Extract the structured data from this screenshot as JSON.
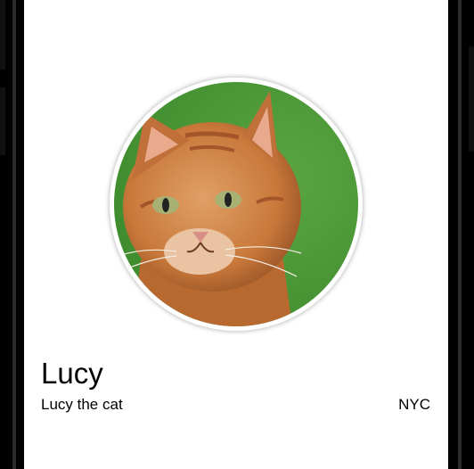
{
  "profile": {
    "name": "Lucy",
    "subtitle": "Lucy the cat",
    "location": "NYC"
  },
  "avatar": {
    "icon": "cat-photo",
    "background_color": "#4e9a3a",
    "fur_color": "#c9783a"
  }
}
